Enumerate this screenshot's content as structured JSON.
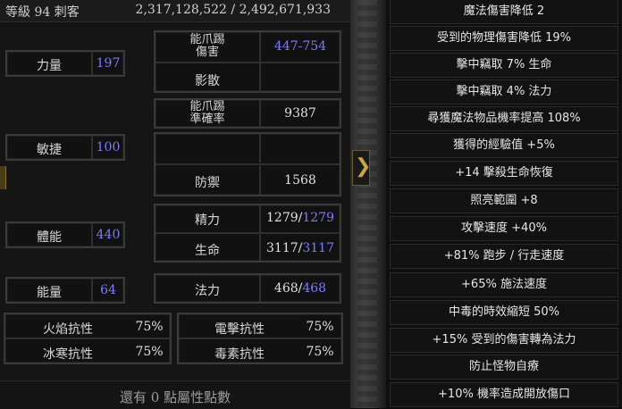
{
  "header": {
    "level_class": "等級 94 刺客",
    "experience": "2,317,128,522 / 2,492,671,933"
  },
  "attributes": [
    {
      "label": "力量",
      "value": "197"
    },
    {
      "label": "敏捷",
      "value": "100"
    },
    {
      "label": "體能",
      "value": "440"
    },
    {
      "label": "能量",
      "value": "64"
    }
  ],
  "combat": {
    "damage_label": "能爪踢\n傷害",
    "damage_value": "447-754",
    "shadow_label": "影散",
    "attack_rating_label": "能爪踢\n準確率",
    "attack_rating_value": "9387",
    "defense_label": "防禦",
    "defense_value": "1568",
    "stamina_label": "精力",
    "stamina_current": "1279",
    "stamina_max": "1279",
    "life_label": "生命",
    "life_current": "3117",
    "life_max": "3117",
    "mana_label": "法力",
    "mana_current": "468",
    "mana_max": "468"
  },
  "resistances": {
    "fire_label": "火焰抗性",
    "fire_value": "75%",
    "lightning_label": "電擊抗性",
    "lightning_value": "75%",
    "cold_label": "冰寒抗性",
    "cold_value": "75%",
    "poison_label": "毒素抗性",
    "poison_value": "75%"
  },
  "footer": {
    "stat_points": "還有 0 點屬性點數"
  },
  "bonuses": [
    "魔法傷害降低 2",
    "受到的物理傷害降低 19%",
    "擊中竊取 7% 生命",
    "擊中竊取 4% 法力",
    "尋獲魔法物品機率提高 108%",
    "獲得的經驗值 +5%",
    "+14 擊殺生命恢復",
    "照亮範圍 +8",
    "攻擊速度 +40%",
    "+81% 跑步 / 行走速度",
    "+65% 施法速度",
    "中毒的時效縮短 50%",
    "+15% 受到的傷害轉為法力",
    "防止怪物自療",
    "+10% 機率造成開放傷口"
  ],
  "colors": {
    "stat_blue": "#7b7bff",
    "text": "#d8d8d8",
    "gold": "#c9a44a"
  }
}
